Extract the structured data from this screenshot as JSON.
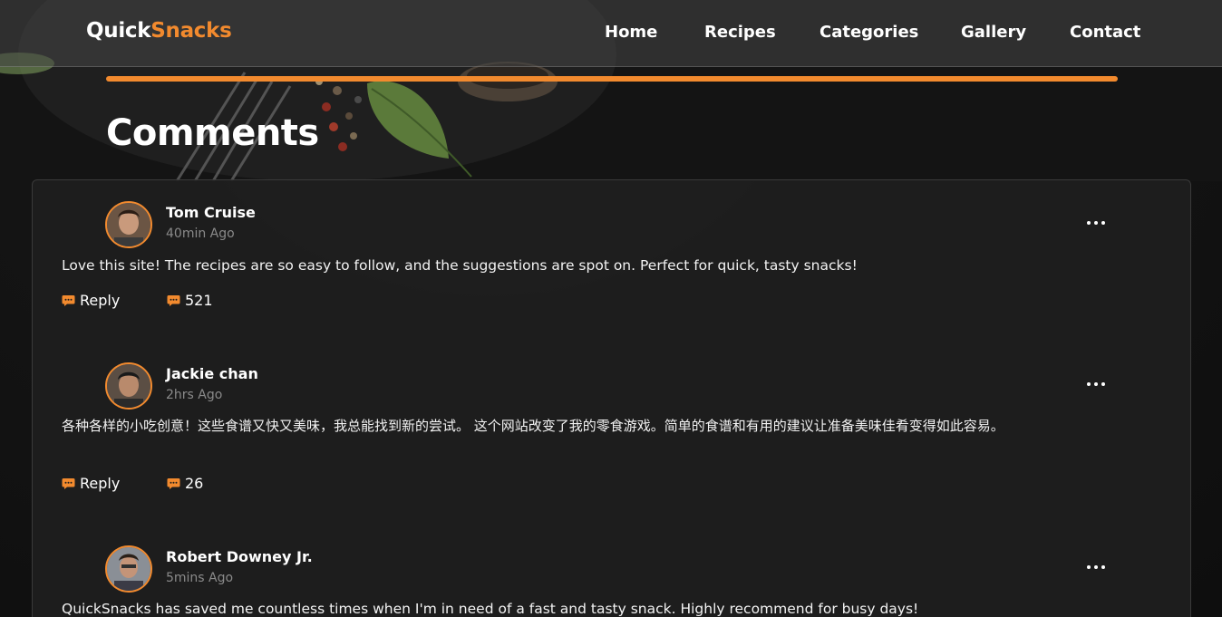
{
  "brand": {
    "part1": "Quick",
    "part2": "Snacks",
    "accent": "#f28a2e"
  },
  "nav": {
    "items": [
      {
        "label": "Home"
      },
      {
        "label": "Recipes"
      },
      {
        "label": "Categories"
      },
      {
        "label": "Gallery"
      },
      {
        "label": "Contact"
      }
    ]
  },
  "section": {
    "title": "Comments"
  },
  "comments": [
    {
      "name": "Tom Cruise",
      "time": "40min Ago",
      "text": "Love this site! The recipes are so easy to follow, and the suggestions are spot on. Perfect for quick, tasty snacks!",
      "reply_label": "Reply",
      "count": "521",
      "more_icon": "more-horizontal-icon"
    },
    {
      "name": "Jackie chan",
      "time": "2hrs Ago",
      "text": "各种各样的小吃创意！这些食谱又快又美味，我总能找到新的尝试。 这个网站改变了我的零食游戏。简单的食谱和有用的建议让准备美味佳肴变得如此容易。",
      "reply_label": "Reply",
      "count": "26",
      "more_icon": "more-horizontal-icon"
    },
    {
      "name": "Robert Downey Jr.",
      "time": "5mins Ago",
      "text": "QuickSnacks has saved me countless times when I'm in need of a fast and tasty snack. Highly recommend for busy days!",
      "more_icon": "more-horizontal-icon"
    }
  ],
  "icons": {
    "reply": "chat-bubble-icon",
    "count": "chat-bubble-icon"
  }
}
